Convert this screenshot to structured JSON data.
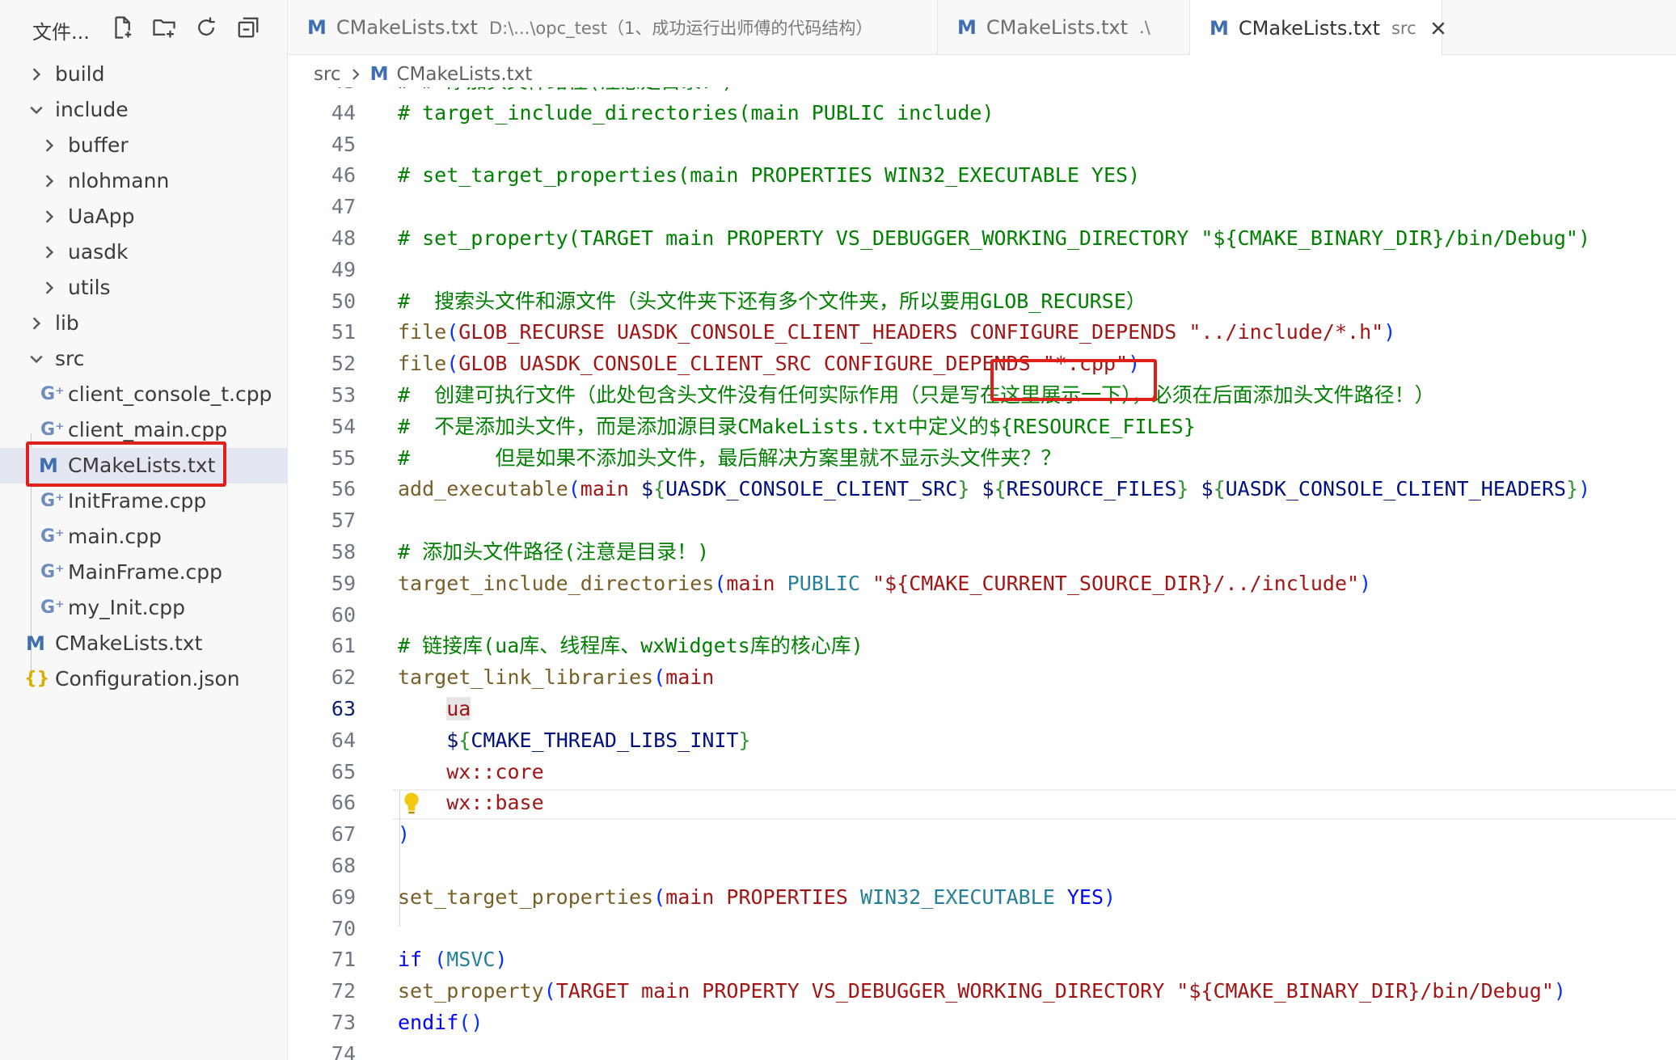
{
  "sidebar": {
    "title": "文件...",
    "actions": [
      "new-file",
      "new-folder",
      "refresh",
      "collapse-all"
    ],
    "items": [
      {
        "label": "build",
        "kind": "folder",
        "state": "collapsed",
        "depth": 0
      },
      {
        "label": "include",
        "kind": "folder",
        "state": "expanded",
        "depth": 0
      },
      {
        "label": "buffer",
        "kind": "folder",
        "state": "collapsed",
        "depth": 1
      },
      {
        "label": "nlohmann",
        "kind": "folder",
        "state": "collapsed",
        "depth": 1
      },
      {
        "label": "UaApp",
        "kind": "folder",
        "state": "collapsed",
        "depth": 1
      },
      {
        "label": "uasdk",
        "kind": "folder",
        "state": "collapsed",
        "depth": 1
      },
      {
        "label": "utils",
        "kind": "folder",
        "state": "collapsed",
        "depth": 1
      },
      {
        "label": "lib",
        "kind": "folder",
        "state": "collapsed",
        "depth": 0
      },
      {
        "label": "src",
        "kind": "folder",
        "state": "expanded",
        "depth": 0
      },
      {
        "label": "client_console_t.cpp",
        "kind": "cpp",
        "depth": 1
      },
      {
        "label": "client_main.cpp",
        "kind": "cpp",
        "depth": 1
      },
      {
        "label": "CMakeLists.txt",
        "kind": "cmake",
        "depth": 1,
        "selected": true
      },
      {
        "label": "InitFrame.cpp",
        "kind": "cpp",
        "depth": 1
      },
      {
        "label": "main.cpp",
        "kind": "cpp",
        "depth": 1
      },
      {
        "label": "MainFrame.cpp",
        "kind": "cpp",
        "depth": 1
      },
      {
        "label": "my_Init.cpp",
        "kind": "cpp",
        "depth": 1
      },
      {
        "label": "CMakeLists.txt",
        "kind": "cmake",
        "depth": 0
      },
      {
        "label": "Configuration.json",
        "kind": "json",
        "depth": 0
      }
    ]
  },
  "tabs": [
    {
      "label": "CMakeLists.txt",
      "description": "D:\\...\\opc_test（1、成功运行出师傅的代码结构）",
      "active": false
    },
    {
      "label": "CMakeLists.txt",
      "description": ".\\",
      "active": false
    },
    {
      "label": "CMakeLists.txt",
      "description": "src",
      "active": true
    }
  ],
  "tab_icon_letter": "M",
  "breadcrumb": {
    "folder": "src",
    "file": "CMakeLists.txt"
  },
  "editor": {
    "current_line": 63,
    "lines": [
      {
        "n": "43",
        "t": [
          [
            "c-com",
            "# # 添加头文件路径(注意是目录！)"
          ]
        ]
      },
      {
        "n": "44",
        "t": [
          [
            "c-com",
            "# target_include_directories(main PUBLIC include)"
          ]
        ]
      },
      {
        "n": "45",
        "t": []
      },
      {
        "n": "46",
        "t": [
          [
            "c-com",
            "# set_target_properties(main PROPERTIES WIN32_EXECUTABLE YES)"
          ]
        ]
      },
      {
        "n": "47",
        "t": []
      },
      {
        "n": "48",
        "t": [
          [
            "c-com",
            "# set_property(TARGET main PROPERTY VS_DEBUGGER_WORKING_DIRECTORY \"${CMAKE_BINARY_DIR}/bin/Debug\")"
          ]
        ]
      },
      {
        "n": "49",
        "t": []
      },
      {
        "n": "50",
        "t": [
          [
            "c-com",
            "#  搜索头文件和源文件（头文件夹下还有多个文件夹，所以要用GLOB_RECURSE）"
          ]
        ]
      },
      {
        "n": "51",
        "t": [
          [
            "c-fn",
            "file"
          ],
          [
            "c-br",
            "("
          ],
          [
            "c-red",
            "GLOB_RECURSE UASDK_CONSOLE_CLIENT_HEADERS CONFIGURE_DEPENDS \"../include/*.h\""
          ],
          [
            "c-br",
            ")"
          ]
        ]
      },
      {
        "n": "52",
        "t": [
          [
            "c-fn",
            "file"
          ],
          [
            "c-br",
            "("
          ],
          [
            "c-red",
            "GLOB UASDK_CONSOLE_CLIENT_SRC CONFIGURE_DEPENDS \"*.cpp\""
          ],
          [
            "c-br",
            ")"
          ]
        ]
      },
      {
        "n": "53",
        "t": [
          [
            "c-com",
            "#  创建可执行文件（此处包含头文件没有任何实际作用（只是写在这里展示一下），必须在后面添加头文件路径！）"
          ]
        ]
      },
      {
        "n": "54",
        "t": [
          [
            "c-com",
            "#  不是添加头文件，而是添加源目录CMakeLists.txt中定义的${RESOURCE_FILES}"
          ]
        ]
      },
      {
        "n": "55",
        "t": [
          [
            "c-com",
            "#       但是如果不添加头文件，最后解决方案里就不显示头文件夹？？"
          ]
        ]
      },
      {
        "n": "56",
        "t": [
          [
            "c-fn",
            "add_executable"
          ],
          [
            "c-br",
            "("
          ],
          [
            "c-red",
            "main "
          ],
          [
            "c-var",
            "$"
          ],
          [
            "c-brc",
            "{"
          ],
          [
            "c-var",
            "UASDK_CONSOLE_CLIENT_SRC"
          ],
          [
            "c-brc",
            "}"
          ],
          [
            "c-txt",
            " "
          ],
          [
            "c-var",
            "$"
          ],
          [
            "c-brc",
            "{"
          ],
          [
            "c-var",
            "RESOURCE_FILES"
          ],
          [
            "c-brc",
            "}"
          ],
          [
            "c-txt",
            " "
          ],
          [
            "c-var",
            "$"
          ],
          [
            "c-brc",
            "{"
          ],
          [
            "c-var",
            "UASDK_CONSOLE_CLIENT_HEADERS"
          ],
          [
            "c-brc",
            "}"
          ],
          [
            "c-br",
            ")"
          ]
        ]
      },
      {
        "n": "57",
        "t": []
      },
      {
        "n": "58",
        "t": [
          [
            "c-com",
            "# 添加头文件路径(注意是目录！)"
          ]
        ]
      },
      {
        "n": "59",
        "t": [
          [
            "c-fn",
            "target_include_directories"
          ],
          [
            "c-br",
            "("
          ],
          [
            "c-red",
            "main "
          ],
          [
            "c-def",
            "PUBLIC"
          ],
          [
            "c-red",
            " \"${CMAKE_CURRENT_SOURCE_DIR}/../include\""
          ],
          [
            "c-br",
            ")"
          ]
        ]
      },
      {
        "n": "60",
        "t": []
      },
      {
        "n": "61",
        "t": [
          [
            "c-com",
            "# 链接库(ua库、线程库、wxWidgets库的核心库)"
          ]
        ]
      },
      {
        "n": "62",
        "t": [
          [
            "c-fn",
            "target_link_libraries"
          ],
          [
            "c-br",
            "("
          ],
          [
            "c-red",
            "main"
          ]
        ]
      },
      {
        "n": "63",
        "t": [
          [
            "c-txt",
            "    "
          ],
          [
            "c-hl",
            "ua"
          ]
        ]
      },
      {
        "n": "64",
        "t": [
          [
            "c-txt",
            "    "
          ],
          [
            "c-var",
            "$"
          ],
          [
            "c-brc",
            "{"
          ],
          [
            "c-var",
            "CMAKE_THREAD_LIBS_INIT"
          ],
          [
            "c-brc",
            "}"
          ]
        ]
      },
      {
        "n": "65",
        "t": [
          [
            "c-txt",
            "    "
          ],
          [
            "c-red",
            "wx::core"
          ]
        ]
      },
      {
        "n": "66",
        "t": [
          [
            "c-txt",
            "    "
          ],
          [
            "c-red",
            "wx::base"
          ]
        ]
      },
      {
        "n": "67",
        "t": [
          [
            "c-br",
            ")"
          ]
        ]
      },
      {
        "n": "68",
        "t": []
      },
      {
        "n": "69",
        "t": [
          [
            "c-fn",
            "set_target_properties"
          ],
          [
            "c-br",
            "("
          ],
          [
            "c-red",
            "main PROPERTIES "
          ],
          [
            "c-def",
            "WIN32_EXECUTABLE"
          ],
          [
            "c-txt",
            " "
          ],
          [
            "c-kw",
            "YES"
          ],
          [
            "c-br",
            ")"
          ]
        ]
      },
      {
        "n": "70",
        "t": []
      },
      {
        "n": "71",
        "t": [
          [
            "c-kw",
            "if"
          ],
          [
            "c-txt",
            " "
          ],
          [
            "c-br",
            "("
          ],
          [
            "c-def",
            "MSVC"
          ],
          [
            "c-br",
            ")"
          ]
        ]
      },
      {
        "n": "72",
        "t": [
          [
            "c-fn",
            "set_property"
          ],
          [
            "c-br",
            "("
          ],
          [
            "c-red",
            "TARGET main PROPERTY VS_DEBUGGER_WORKING_DIRECTORY \"${CMAKE_BINARY_DIR}/bin/Debug\""
          ],
          [
            "c-br",
            ")"
          ]
        ]
      },
      {
        "n": "73",
        "t": [
          [
            "c-kw",
            "endif"
          ],
          [
            "c-br",
            "()"
          ]
        ]
      },
      {
        "n": "74",
        "t": []
      }
    ]
  },
  "colors": {
    "accent_red": "#e0201a",
    "selection": "#e4e6f1",
    "cmake_icon": "#3f6fb0"
  }
}
